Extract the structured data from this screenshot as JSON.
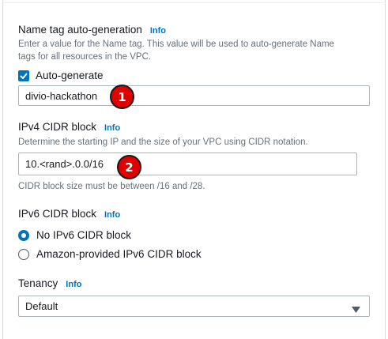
{
  "name_tag": {
    "label": "Name tag auto-generation",
    "info": "Info",
    "description_line1": "Enter a value for the Name tag. This value will be used to auto-generate Name",
    "description_line2": "tags for all resources in the VPC.",
    "auto_generate_label": "Auto-generate",
    "auto_generate_checked": true,
    "value": "divio-hackathon",
    "annotation": "1"
  },
  "ipv4": {
    "label": "IPv4 CIDR block",
    "info": "Info",
    "description": "Determine the starting IP and the size of your VPC using CIDR notation.",
    "value": "10.<rand>.0.0/16",
    "annotation": "2",
    "hint": "CIDR block size must be between /16 and /28."
  },
  "ipv6": {
    "label": "IPv6 CIDR block",
    "info": "Info",
    "options": [
      {
        "label": "No IPv6 CIDR block",
        "selected": true
      },
      {
        "label": "Amazon-provided IPv6 CIDR block",
        "selected": false
      }
    ]
  },
  "tenancy": {
    "label": "Tenancy",
    "info": "Info",
    "selected": "Default"
  },
  "colors": {
    "accent": "#0073bb",
    "annotation_badge": "#e00000"
  }
}
